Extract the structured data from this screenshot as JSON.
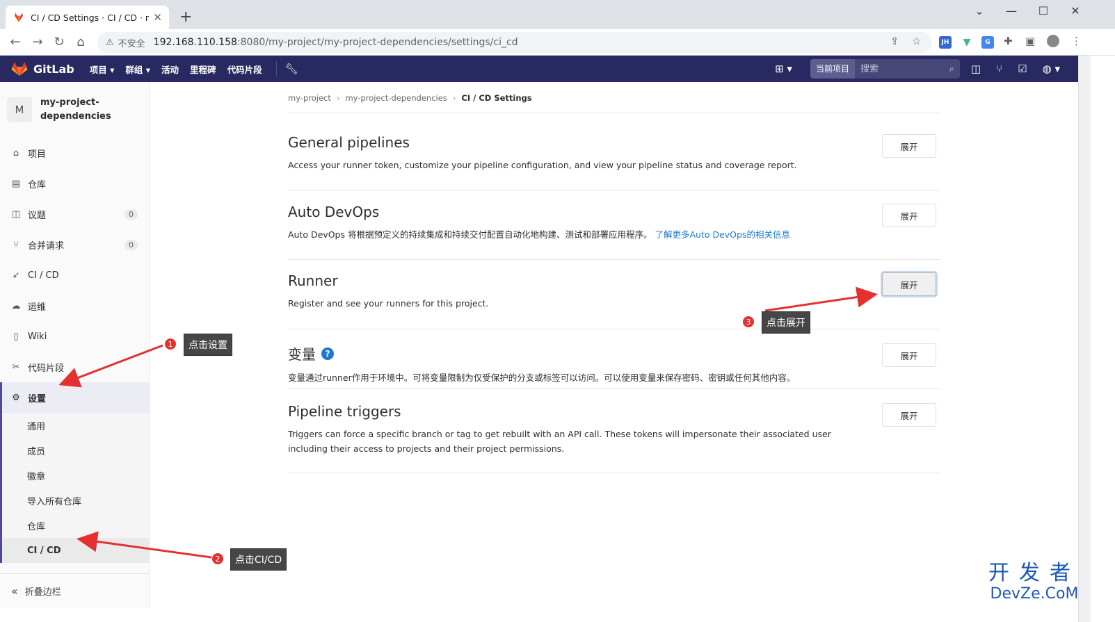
{
  "browser": {
    "tab_title": "CI / CD Settings · CI / CD · my-",
    "security_label": "不安全",
    "url_host": "192.168.110.158",
    "url_path": ":8080/my-project/my-project-dependencies/settings/ci_cd",
    "extension_jh": "JH"
  },
  "topnav": {
    "brand": "GitLab",
    "menu": [
      "项目",
      "群组",
      "活动",
      "里程碑",
      "代码片段"
    ],
    "search_scope": "当前项目",
    "search_placeholder": "搜索"
  },
  "sidebar": {
    "avatar_letter": "M",
    "project_name": "my-project-dependencies",
    "items": [
      {
        "label": "项目",
        "icon": "home-icon"
      },
      {
        "label": "仓库",
        "icon": "repo-icon"
      },
      {
        "label": "议题",
        "icon": "issues-icon",
        "count": "0"
      },
      {
        "label": "合并请求",
        "icon": "merge-request-icon",
        "count": "0"
      },
      {
        "label": "CI / CD",
        "icon": "rocket-icon"
      },
      {
        "label": "运维",
        "icon": "cloud-gear-icon"
      },
      {
        "label": "Wiki",
        "icon": "book-icon"
      },
      {
        "label": "代码片段",
        "icon": "scissors-icon"
      },
      {
        "label": "设置",
        "icon": "gear-icon"
      }
    ],
    "sub_items": [
      "通用",
      "成员",
      "徽章",
      "导入所有仓库",
      "仓库",
      "CI / CD"
    ],
    "collapse_label": "折叠边栏"
  },
  "breadcrumb": [
    "my-project",
    "my-project-dependencies",
    "CI / CD Settings"
  ],
  "sections": [
    {
      "title": "General pipelines",
      "desc": "Access your runner token, customize your pipeline configuration, and view your pipeline status and coverage report.",
      "button": "展开"
    },
    {
      "title": "Auto DevOps",
      "desc": "Auto DevOps 将根据预定义的持续集成和持续交付配置自动化地构建、测试和部署应用程序。",
      "link": "了解更多Auto DevOps的相关信息",
      "button": "展开"
    },
    {
      "title": "Runner",
      "desc": "Register and see your runners for this project.",
      "button": "展开"
    },
    {
      "title": "变量",
      "desc": "变量通过runner作用于环境中。可将变量限制为仅受保护的分支或标签可以访问。可以使用变量来保存密码、密钥或任何其他内容。",
      "button": "展开"
    },
    {
      "title": "Pipeline triggers",
      "desc": "Triggers can force a specific branch or tag to get rebuilt with an API call. These tokens will impersonate their associated user including their access to projects and their project permissions.",
      "button": "展开"
    }
  ],
  "annotations": [
    {
      "num": "1",
      "text": "点击设置"
    },
    {
      "num": "2",
      "text": "点击CI/CD"
    },
    {
      "num": "3",
      "text": "点击展开"
    }
  ],
  "watermark": {
    "cn": "开发者",
    "en": "DevZe.CoM"
  },
  "colors": {
    "nav_bg": "#292961",
    "accent": "#4b4ba3",
    "link": "#1f78d1",
    "annotation_arrow": "#e53030"
  }
}
